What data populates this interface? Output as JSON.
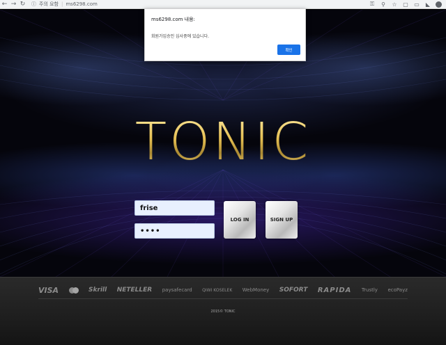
{
  "browser": {
    "back_icon": "back-arrow-icon",
    "forward_icon": "forward-arrow-icon",
    "reload_icon": "reload-icon",
    "security_text": "주의 요함",
    "url": "ms6298.com"
  },
  "dialog": {
    "title": "ms6298.com 내용:",
    "message": "회원가입승인 심사중에 있습니다.",
    "ok_label": "확인",
    "ok_color": "#1a73e8"
  },
  "logo": {
    "text": "TONIC",
    "color": "#d8b44a"
  },
  "login": {
    "username_value": "frise",
    "password_value": "••••",
    "login_label": "LOG IN",
    "signup_label": "SIGN UP"
  },
  "footer": {
    "payments": [
      "VISA",
      "Skrill",
      "NETELLER",
      "paysafecard",
      "QIWI KOSELEK",
      "WebMoney",
      "SOFORT",
      "RAPIDA",
      "Trustly",
      "ecoPayz"
    ],
    "copyright": "2015© TONIC"
  }
}
